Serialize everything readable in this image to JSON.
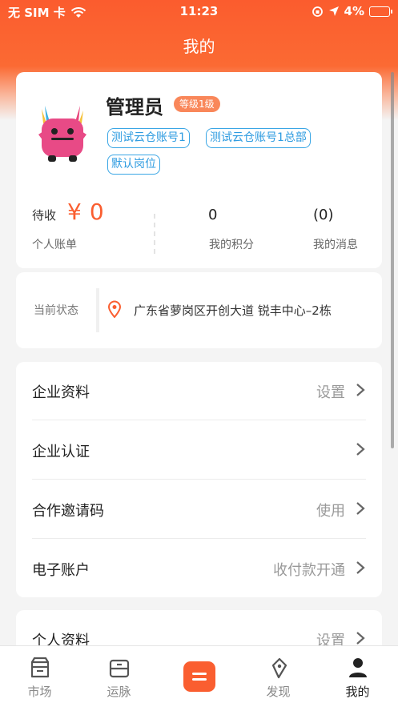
{
  "status_bar": {
    "carrier": "无 SIM 卡",
    "time": "11:23",
    "battery": "4%"
  },
  "nav": {
    "title": "我的"
  },
  "profile": {
    "name": "管理员",
    "level": "等级1级",
    "tags": [
      "测试云仓账号1",
      "测试云仓账号1总部",
      "默认岗位"
    ],
    "pending_label": "待收",
    "currency": "¥",
    "pending_amount": "0",
    "account_label": "个人账单",
    "points_value": "0",
    "points_label": "我的积分",
    "messages_value": "(0)",
    "messages_label": "我的消息"
  },
  "location": {
    "label": "当前状态",
    "address": "广东省萝岗区开创大道   锐丰中心–2栋"
  },
  "menu": [
    {
      "label": "企业资料",
      "value": "设置"
    },
    {
      "label": "企业认证",
      "value": ""
    },
    {
      "label": "合作邀请码",
      "value": "使用"
    },
    {
      "label": "电子账户",
      "value": "收付款开通"
    }
  ],
  "menu2": [
    {
      "label": "个人资料",
      "value": "设置"
    }
  ],
  "tabs": [
    {
      "label": "市场",
      "icon": "market-icon"
    },
    {
      "label": "运脉",
      "icon": "contacts-icon"
    },
    {
      "label": "",
      "icon": "menu-icon"
    },
    {
      "label": "发现",
      "icon": "discover-icon"
    },
    {
      "label": "我的",
      "icon": "profile-icon"
    }
  ],
  "colors": {
    "accent": "#fa5e30",
    "tag_blue": "#3aa6e5",
    "badge": "#f9875a"
  }
}
